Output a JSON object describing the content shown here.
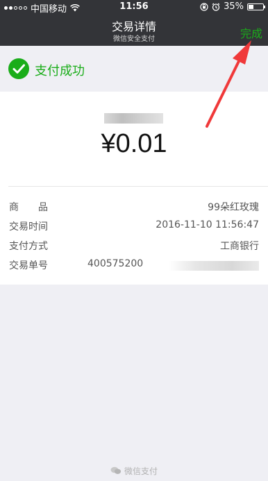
{
  "status_bar": {
    "carrier": "中国移动",
    "time": "11:56",
    "battery": "35%",
    "battery_level": 0.35,
    "signal_full": 2,
    "signal_total": 5
  },
  "nav": {
    "title": "交易详情",
    "subtitle": "微信安全支付",
    "done_label": "完成"
  },
  "result": {
    "text": "支付成功"
  },
  "payment": {
    "amount": "¥0.01"
  },
  "details": [
    {
      "label": "商　　品",
      "value": "99朵红玫瑰"
    },
    {
      "label": "交易时间",
      "value": "2016-11-10 11:56:47"
    },
    {
      "label": "支付方式",
      "value": "工商银行"
    },
    {
      "label": "交易单号",
      "value": "400575200"
    }
  ],
  "footer": {
    "text": "微信支付"
  },
  "colors": {
    "accent": "#1aad19",
    "header_bg": "#333438",
    "page_bg": "#efeff4",
    "annotation_arrow": "#f0393a"
  }
}
